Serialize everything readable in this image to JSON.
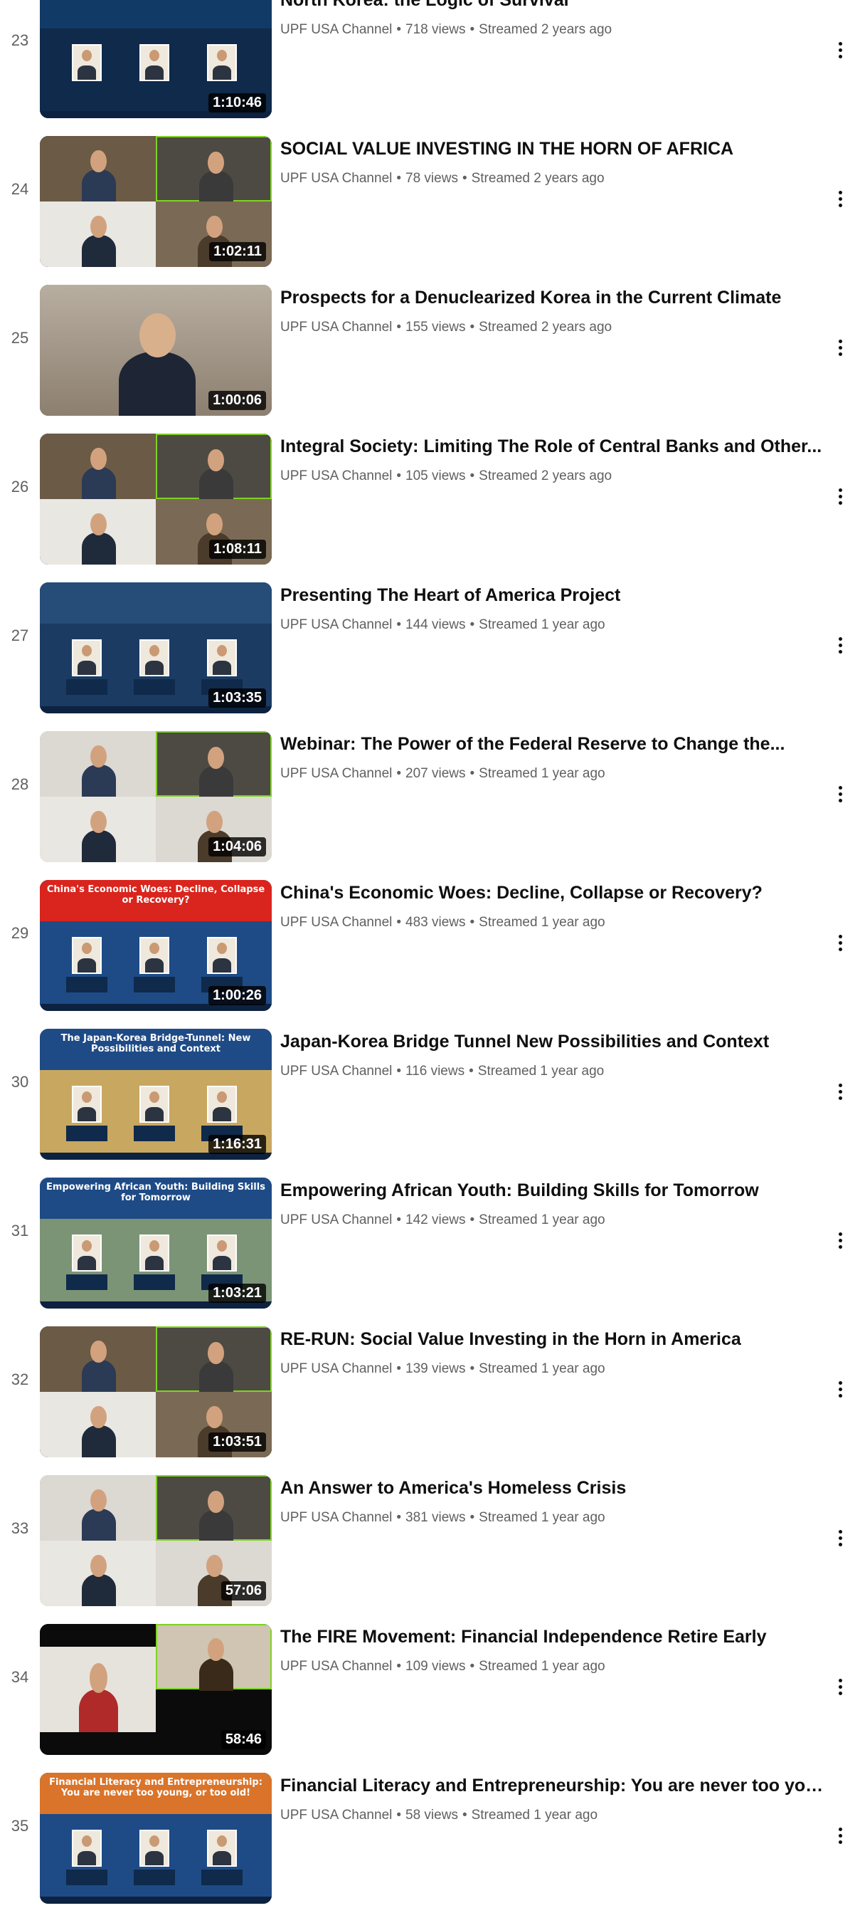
{
  "videos": [
    {
      "index": "23",
      "title": "North Korea: the Logic of Survival",
      "channel": "UPF USA Channel",
      "views": "718 views",
      "age": "Streamed 2 years ago",
      "duration": "1:10:46",
      "art": "poster-blue"
    },
    {
      "index": "24",
      "title": "SOCIAL VALUE INVESTING IN THE HORN OF AFRICA",
      "channel": "UPF USA Channel",
      "views": "78 views",
      "age": "Streamed 2 years ago",
      "duration": "1:02:11",
      "art": "grid"
    },
    {
      "index": "25",
      "title": "Prospects for a Denuclearized Korea in the Current Climate",
      "channel": "UPF USA Channel",
      "views": "155 views",
      "age": "Streamed 2 years ago",
      "duration": "1:00:06",
      "art": "single"
    },
    {
      "index": "26",
      "title": "Integral Society: Limiting The Role of Central Banks and Other...",
      "channel": "UPF USA Channel",
      "views": "105 views",
      "age": "Streamed 2 years ago",
      "duration": "1:08:11",
      "art": "grid"
    },
    {
      "index": "27",
      "title": "Presenting The Heart of America Project",
      "channel": "UPF USA Channel",
      "views": "144 views",
      "age": "Streamed 1 year ago",
      "duration": "1:03:35",
      "art": "poster-globe"
    },
    {
      "index": "28",
      "title": "Webinar: The Power of the Federal Reserve to Change the...",
      "channel": "UPF USA Channel",
      "views": "207 views",
      "age": "Streamed 1 year ago",
      "duration": "1:04:06",
      "art": "grid-light"
    },
    {
      "index": "29",
      "title": "China's Economic Woes: Decline, Collapse or Recovery?",
      "channel": "UPF USA Channel",
      "views": "483 views",
      "age": "Streamed 1 year ago",
      "duration": "1:00:26",
      "art": "poster-red"
    },
    {
      "index": "30",
      "title": "Japan-Korea Bridge Tunnel New Possibilities and Context",
      "channel": "UPF USA Channel",
      "views": "116 views",
      "age": "Streamed 1 year ago",
      "duration": "1:16:31",
      "art": "poster-tan"
    },
    {
      "index": "31",
      "title": "Empowering African Youth: Building Skills for Tomorrow",
      "channel": "UPF USA Channel",
      "views": "142 views",
      "age": "Streamed 1 year ago",
      "duration": "1:03:21",
      "art": "poster-green"
    },
    {
      "index": "32",
      "title": "RE-RUN: Social Value Investing in the Horn in America",
      "channel": "UPF USA Channel",
      "views": "139 views",
      "age": "Streamed 1 year ago",
      "duration": "1:03:51",
      "art": "grid"
    },
    {
      "index": "33",
      "title": "An Answer to America's Homeless Crisis",
      "channel": "UPF USA Channel",
      "views": "381 views",
      "age": "Streamed 1 year ago",
      "duration": "57:06",
      "art": "grid-light"
    },
    {
      "index": "34",
      "title": "The FIRE Movement: Financial Independence Retire Early",
      "channel": "UPF USA Channel",
      "views": "109 views",
      "age": "Streamed 1 year ago",
      "duration": "58:46",
      "art": "dark-duo"
    },
    {
      "index": "35",
      "title": "Financial Literacy and Entrepreneurship: You are never too youn...",
      "channel": "UPF USA Channel",
      "views": "58 views",
      "age": "Streamed 1 year ago",
      "duration": "",
      "art": "poster-orange"
    }
  ],
  "poster_text": {
    "29": "China's Economic Woes: Decline, Collapse or Recovery?",
    "30": "The Japan-Korea Bridge-Tunnel: New Possibilities and Context",
    "31": "Empowering African Youth: Building Skills for Tomorrow",
    "35": "Financial Literacy and Entrepreneurship: You are never too young, or too old!"
  },
  "colors": {
    "text": "#0f0f0f",
    "secondary": "#606060",
    "background": "#ffffff"
  }
}
